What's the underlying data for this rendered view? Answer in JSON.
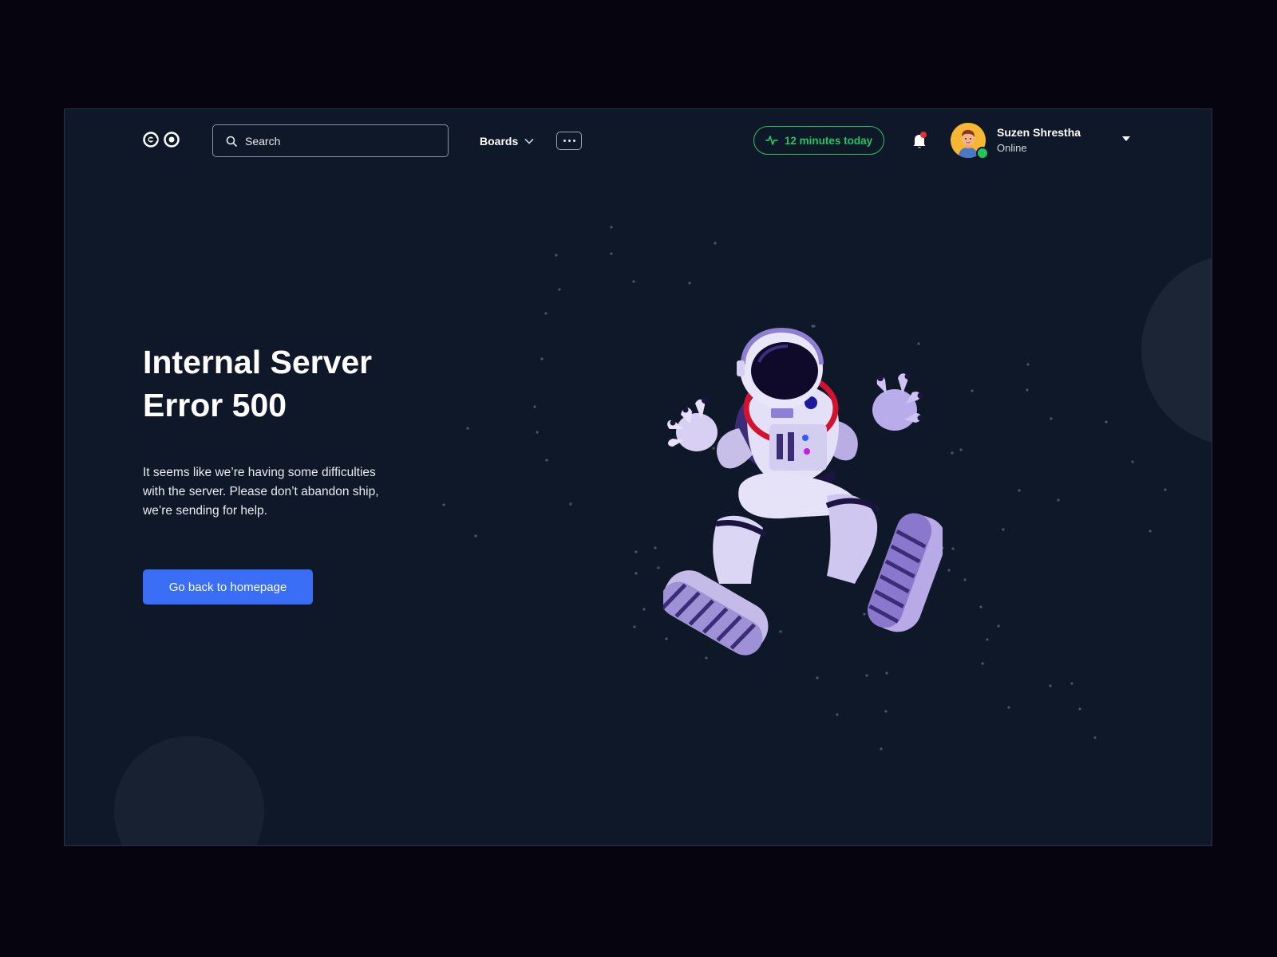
{
  "header": {
    "logo_icon": "logo-two-circles",
    "search": {
      "placeholder": "Search",
      "icon": "search-icon"
    },
    "boards_label": "Boards",
    "more_icon": "ellipsis-icon",
    "activity": {
      "label": "12 minutes today",
      "icon": "activity-pulse-icon",
      "color": "#22c55e"
    },
    "notifications": {
      "icon": "bell-icon",
      "has_unread": true,
      "badge_color": "#ef2b3a"
    },
    "user": {
      "name": "Suzen Shrestha",
      "status": "Online",
      "status_color": "#22c55e"
    }
  },
  "error": {
    "title_line1": "Internal Server",
    "title_line2": "Error 500",
    "description": "It seems like we’re having some difficulties with the server. Please don’t abandon ship, we’re sending for help.",
    "button_label": "Go back to homepage"
  },
  "colors": {
    "background": "#05040f",
    "panel": "#0e1828",
    "accent": "#3b6ef6"
  }
}
